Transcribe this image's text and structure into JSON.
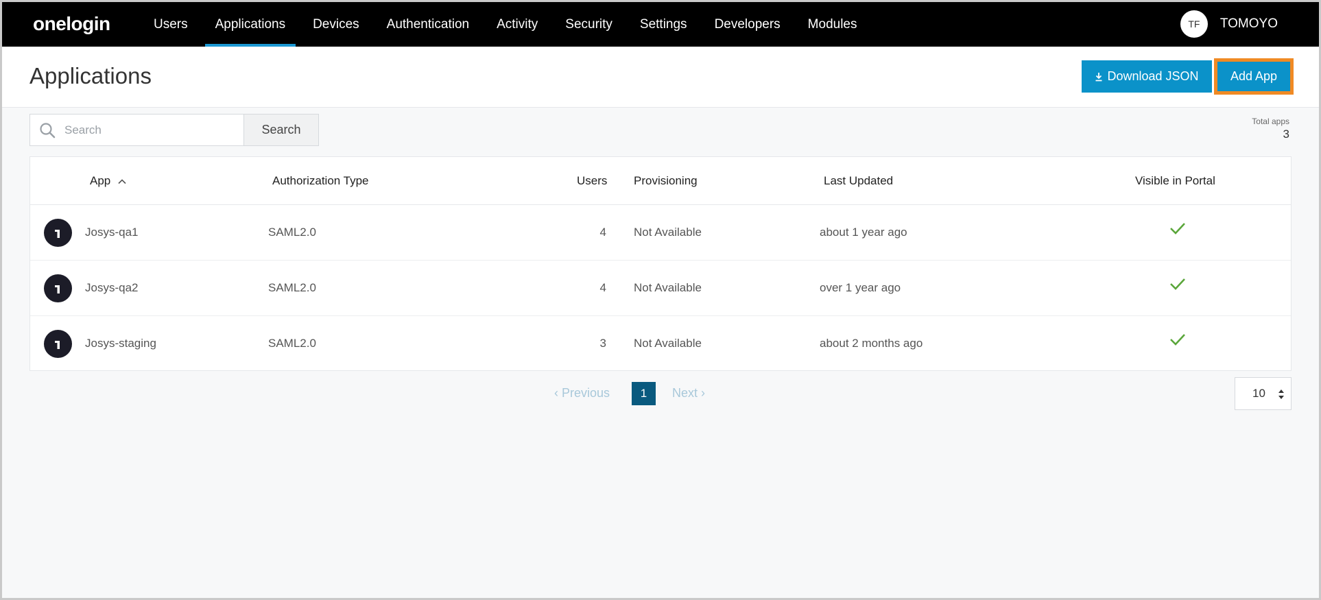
{
  "nav": {
    "logo": "onelogin",
    "items": [
      {
        "label": "Users"
      },
      {
        "label": "Applications",
        "active": true
      },
      {
        "label": "Devices"
      },
      {
        "label": "Authentication"
      },
      {
        "label": "Activity"
      },
      {
        "label": "Security"
      },
      {
        "label": "Settings"
      },
      {
        "label": "Developers"
      },
      {
        "label": "Modules"
      }
    ],
    "user": {
      "initials": "TF",
      "name": "TOMOYO"
    }
  },
  "header": {
    "title": "Applications",
    "download_label": "Download JSON",
    "add_label": "Add App"
  },
  "search": {
    "placeholder": "Search",
    "value": "",
    "button_label": "Search"
  },
  "summary": {
    "total_label": "Total apps",
    "total_value": "3"
  },
  "table": {
    "columns": {
      "app": "App",
      "auth": "Authorization Type",
      "users": "Users",
      "provisioning": "Provisioning",
      "updated": "Last Updated",
      "visible": "Visible in Portal"
    },
    "rows": [
      {
        "name": "Josys-qa1",
        "auth": "SAML2.0",
        "users": "4",
        "provisioning": "Not Available",
        "updated": "about 1 year ago",
        "visible": true
      },
      {
        "name": "Josys-qa2",
        "auth": "SAML2.0",
        "users": "4",
        "provisioning": "Not Available",
        "updated": "over 1 year ago",
        "visible": true
      },
      {
        "name": "Josys-staging",
        "auth": "SAML2.0",
        "users": "3",
        "provisioning": "Not Available",
        "updated": "about 2 months ago",
        "visible": true
      }
    ]
  },
  "pagination": {
    "prev_label": "Previous",
    "current_page": "1",
    "next_label": "Next",
    "per_page": "10"
  },
  "colors": {
    "accent": "#0b92c9",
    "active_page": "#0a5a7f",
    "focus_outline": "#f08a24",
    "check": "#5aa63a"
  }
}
